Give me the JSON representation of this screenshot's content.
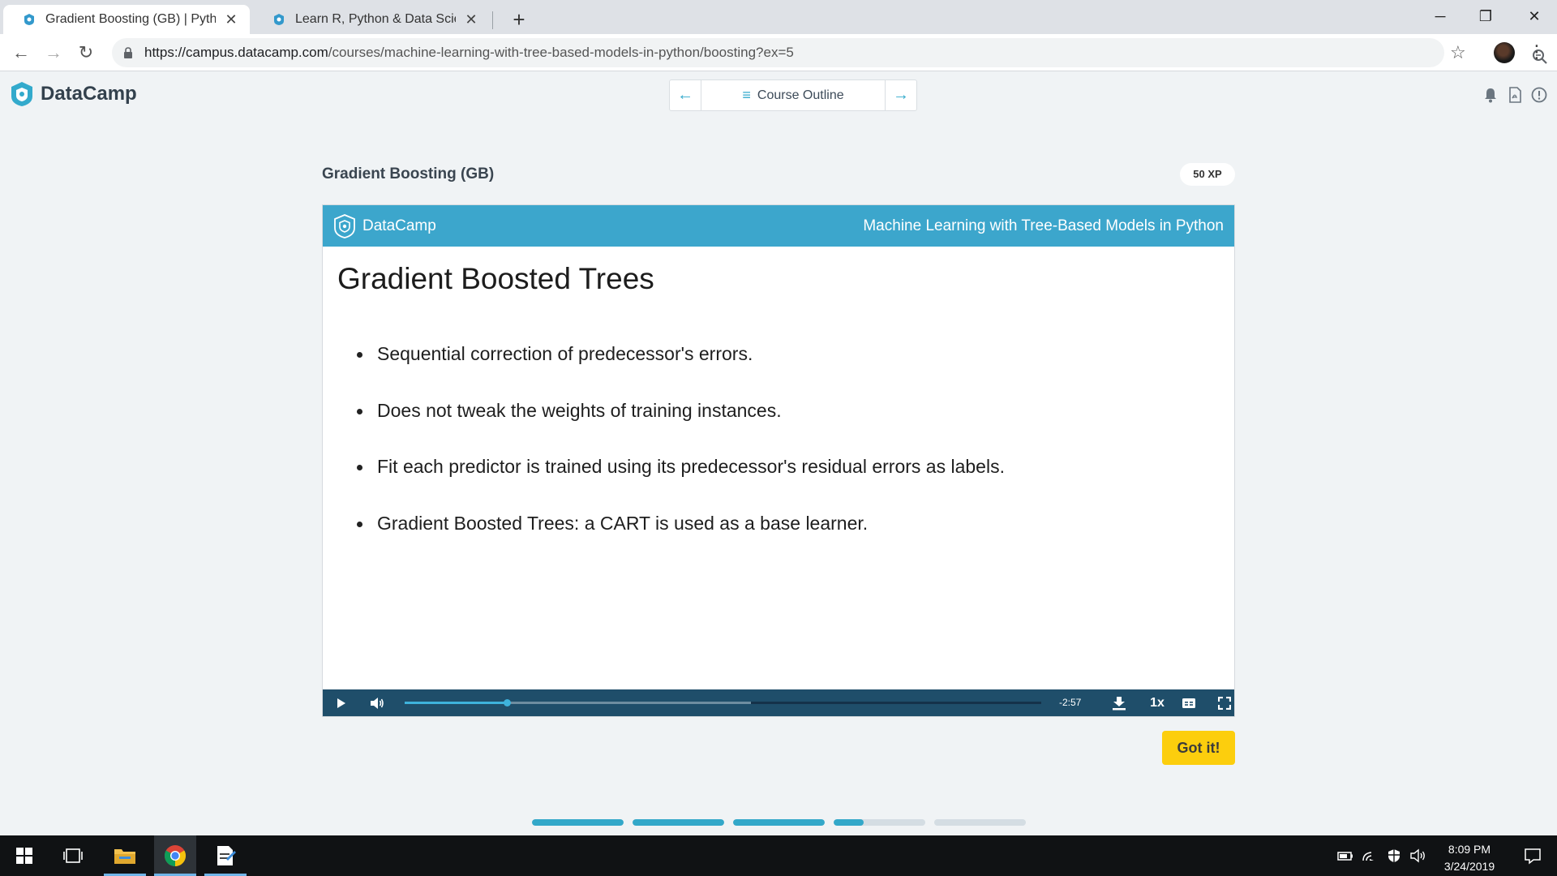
{
  "browser": {
    "tabs": [
      {
        "title": "Gradient Boosting (GB) | Python",
        "active": true
      },
      {
        "title": "Learn R, Python & Data Science Online",
        "active": false
      }
    ],
    "new_tab_label": "+",
    "window_controls": {
      "minimize": "─",
      "restore": "❐",
      "close": "✕"
    },
    "nav": {
      "back": "←",
      "forward": "→",
      "reload": "↻"
    },
    "url": {
      "host": "https://campus.datacamp.com",
      "path": "/courses/machine-learning-with-tree-based-models-in-python/boosting?ex=5"
    },
    "icons": [
      "lock-icon",
      "zoom-icon",
      "star-icon",
      "profile-avatar",
      "menu-icon"
    ],
    "star_glyph": "☆",
    "menu_glyph": "⋮"
  },
  "app": {
    "brand": "DataCamp",
    "nav": {
      "prev": "←",
      "outline_label": "Course Outline",
      "outline_glyph": "≡",
      "next": "→"
    },
    "header_icons": [
      "bell-icon",
      "pdf-icon",
      "info-icon"
    ]
  },
  "exercise": {
    "title": "Gradient Boosting (GB)",
    "xp": "50 XP",
    "slide": {
      "brand": "DataCamp",
      "course": "Machine Learning with Tree-Based Models in Python",
      "title": "Gradient Boosted Trees",
      "bullets": [
        "Sequential correction of predecessor's errors.",
        "Does not tweak the weights of training instances.",
        "Fit each predictor is trained using its predecessor's residual errors as labels.",
        "Gradient Boosted Trees: a CART is used as a base learner."
      ]
    },
    "player": {
      "played_fraction": 0.16,
      "buffered_fraction": 0.544,
      "time_remaining": "-2:57",
      "speed": "1x",
      "icons": [
        "play-icon",
        "volume-icon",
        "download-icon",
        "captions-icon",
        "fullscreen-icon"
      ]
    },
    "got_it_label": "Got it!",
    "progress_steps": [
      1,
      1,
      1,
      0.33,
      0
    ]
  },
  "taskbar": {
    "apps": [
      "start-icon",
      "task-view-icon",
      "file-explorer-icon",
      "chrome-icon",
      "notepad-icon"
    ],
    "tray_icons": [
      "battery-icon",
      "wifi-icon",
      "security-icon",
      "speaker-icon"
    ],
    "time": "8:09 PM",
    "date": "3/24/2019"
  },
  "colors": {
    "accent": "#33aacc",
    "slide_header": "#3ca6cc",
    "player_bar": "#1f4e6a",
    "got_it": "#fcce0d",
    "taskbar": "#101214"
  }
}
